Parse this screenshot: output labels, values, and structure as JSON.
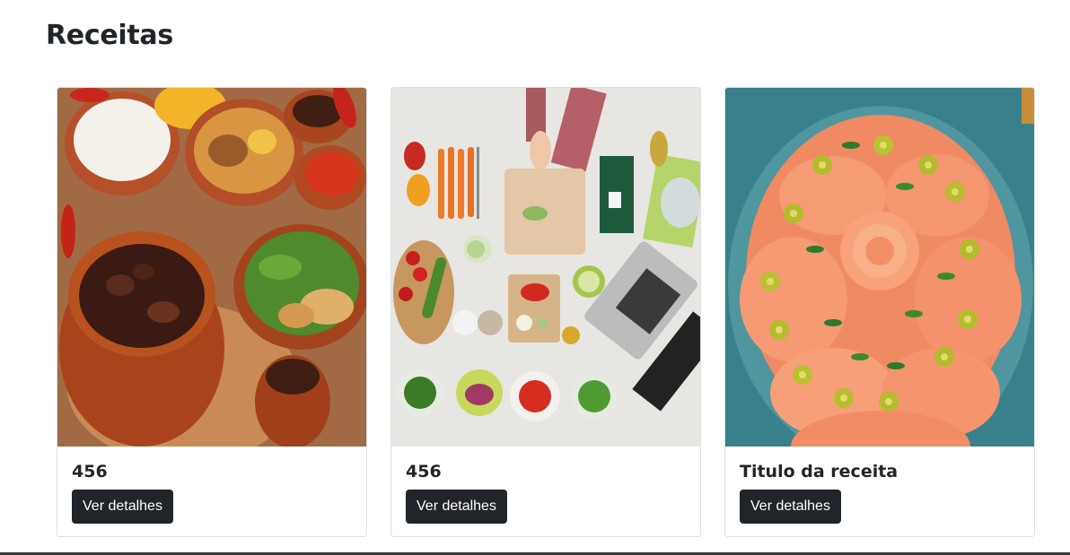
{
  "page": {
    "title": "Receitas"
  },
  "recipes": [
    {
      "title": "456",
      "button_label": "Ver detalhes",
      "image_icon": "feijoada-photo"
    },
    {
      "title": "456",
      "button_label": "Ver detalhes",
      "image_icon": "vegetables-prep-photo"
    },
    {
      "title": "Titulo da receita",
      "button_label": "Ver detalhes",
      "image_icon": "salmon-carpaccio-photo"
    }
  ],
  "colors": {
    "button_bg": "#212529",
    "button_text": "#ffffff",
    "card_border": "#dfdfdf",
    "title_text": "#212529"
  }
}
